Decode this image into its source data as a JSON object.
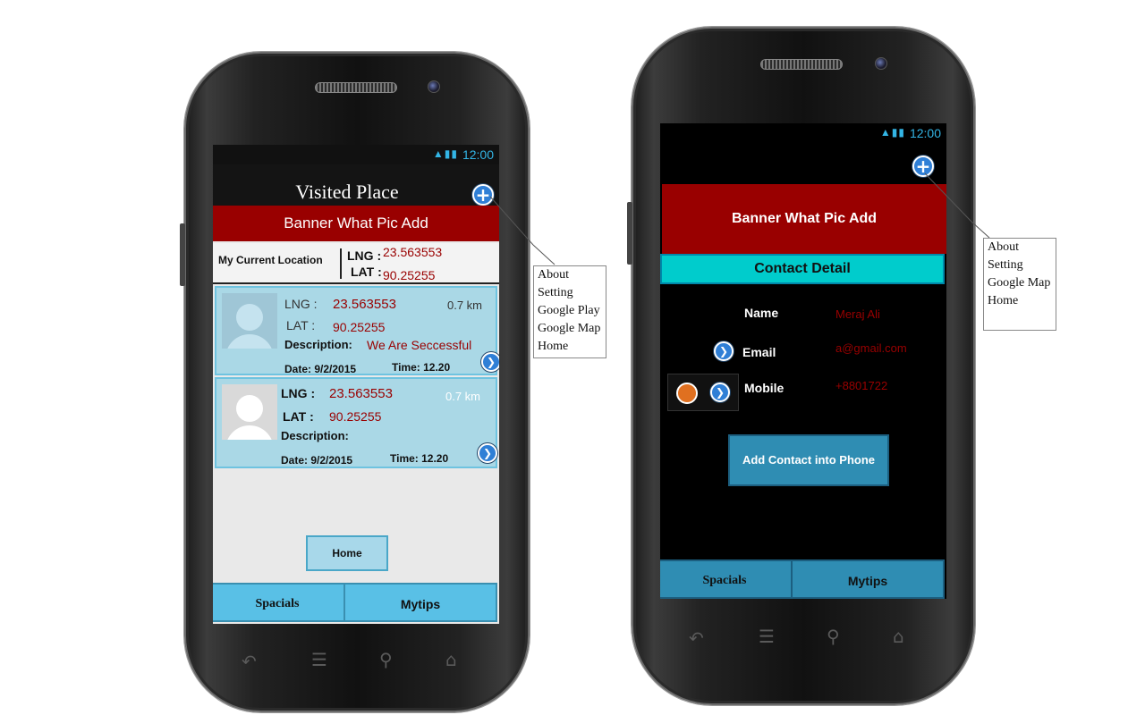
{
  "status_bar": {
    "time": "12:00"
  },
  "left_phone": {
    "title": "Visited Place",
    "banner": "Banner What Pic Add",
    "current_location": {
      "label": "My Current Location",
      "lng_label": "LNG :",
      "lng_value": "23.563553",
      "lat_label": "LAT :",
      "lat_value": "90.25255"
    },
    "places": [
      {
        "lng_label": "LNG :",
        "lng": "23.563553",
        "lat_label": "LAT :",
        "lat": "90.25255",
        "distance": "0.7 km",
        "desc_label": "Description:",
        "desc": "We Are Seccessful",
        "date": "Date: 9/2/2015",
        "time": "Time: 12.20"
      },
      {
        "lng_label": "LNG :",
        "lng": "23.563553",
        "lat_label": "LAT :",
        "lat": "90.25255",
        "distance": "0.7 km",
        "desc_label": "Description:",
        "desc": "",
        "date": "Date: 9/2/2015",
        "time": "Time: 12.20"
      }
    ],
    "home_button": "Home",
    "tabs": [
      "Spacials",
      "Mytips"
    ],
    "menu": [
      "About",
      "Setting",
      "Google Play",
      "Google Map",
      "Home"
    ]
  },
  "right_phone": {
    "banner": "Banner What Pic Add",
    "section_title": "Contact Detail",
    "fields": [
      {
        "label": "Name",
        "value": "Meraj Ali"
      },
      {
        "label": "Email",
        "value": "a@gmail.com"
      },
      {
        "label": "Mobile",
        "value": "+8801722"
      }
    ],
    "add_button": "Add Contact into Phone",
    "tabs": [
      "Spacials",
      "Mytips"
    ],
    "menu": [
      "About",
      "Setting",
      "Google Map",
      "Home"
    ]
  },
  "icons": [
    "plus-icon",
    "arrow-right-icon",
    "contact-person-icon",
    "wifi-icon",
    "signal-icon",
    "battery-icon",
    "back-icon",
    "menu-icon",
    "search-icon",
    "home-icon"
  ],
  "colors": {
    "banner": "#990000",
    "card": "#aad8e6",
    "contact_bar": "#00cccc",
    "tab_left": "#59c0e6",
    "tab_right": "#2f8db3",
    "status_text": "#33b5e5"
  }
}
